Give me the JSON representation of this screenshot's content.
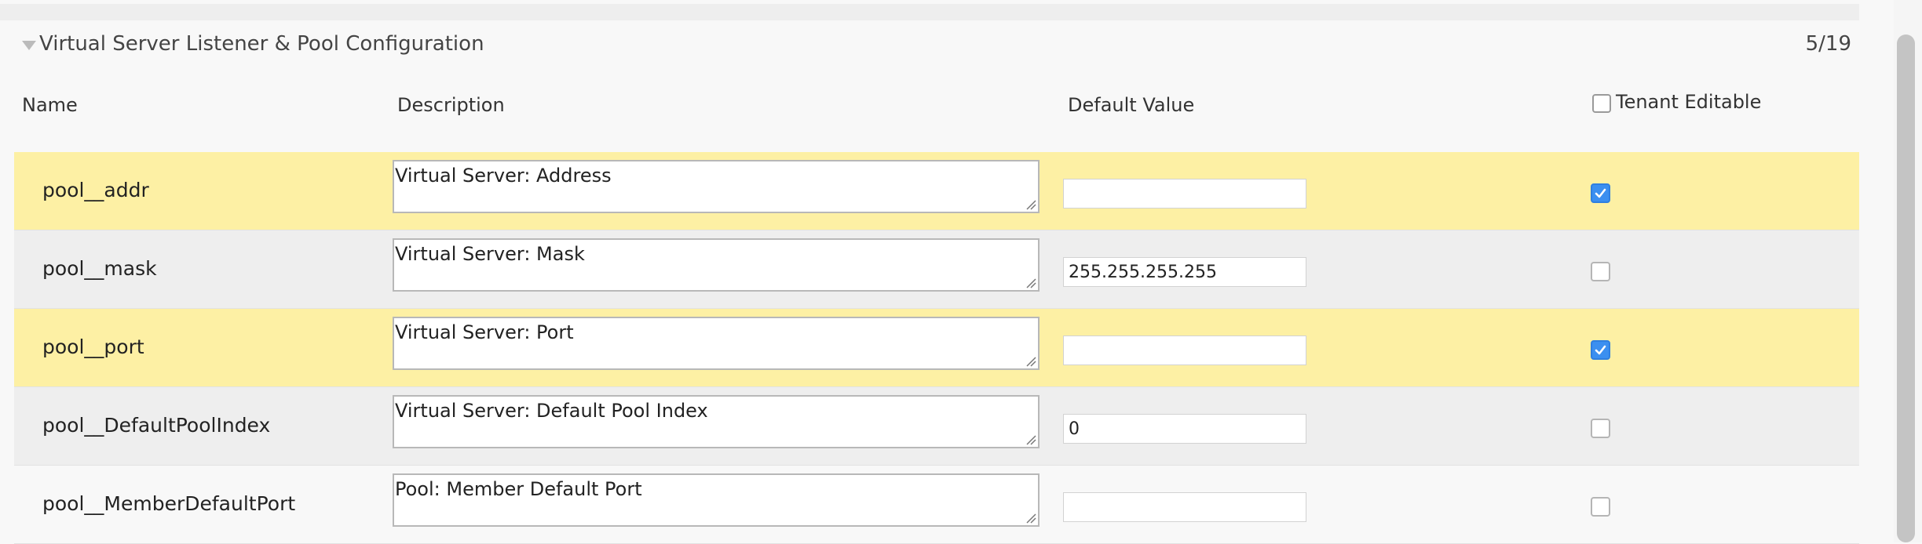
{
  "section": {
    "title": "Virtual Server Listener & Pool Configuration",
    "count": "5/19"
  },
  "columns": {
    "name": "Name",
    "description": "Description",
    "default_value": "Default Value",
    "tenant_editable": "Tenant Editable"
  },
  "rows": [
    {
      "name": "pool__addr",
      "description": "Virtual Server: Address",
      "value": "",
      "editable": true
    },
    {
      "name": "pool__mask",
      "description": "Virtual Server: Mask",
      "value": "255.255.255.255",
      "editable": false
    },
    {
      "name": "pool__port",
      "description": "Virtual Server: Port",
      "value": "",
      "editable": true
    },
    {
      "name": "pool__DefaultPoolIndex",
      "description": "Virtual Server: Default Pool Index",
      "value": "0",
      "editable": false
    },
    {
      "name": "pool__MemberDefaultPort",
      "description": "Pool: Member Default Port",
      "value": "",
      "editable": false
    }
  ],
  "colors": {
    "highlight_row": "#fdf0a4",
    "checkbox_checked": "#3b8ff0"
  }
}
